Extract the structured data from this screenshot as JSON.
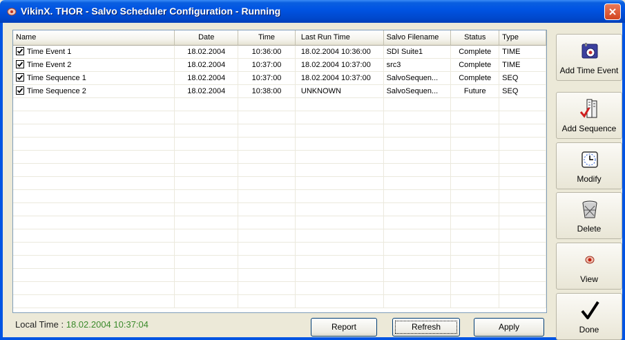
{
  "window": {
    "title": "VikinX. THOR - Salvo Scheduler Configuration - Running"
  },
  "list": {
    "columns": [
      "Name",
      "Date",
      "Time",
      "Last Run Time",
      "Salvo Filename",
      "Status",
      "Type"
    ],
    "rows": [
      {
        "checked": true,
        "name": "Time Event 1",
        "date": "18.02.2004",
        "time": "10:36:00",
        "last_run": "18.02.2004 10:36:00",
        "file": "SDI Suite1",
        "status": "Complete",
        "type": "TIME"
      },
      {
        "checked": true,
        "name": "Time Event 2",
        "date": "18.02.2004",
        "time": "10:37:00",
        "last_run": "18.02.2004 10:37:00",
        "file": "src3",
        "status": "Complete",
        "type": "TIME"
      },
      {
        "checked": true,
        "name": "Time Sequence 1",
        "date": "18.02.2004",
        "time": "10:37:00",
        "last_run": "18.02.2004 10:37:00",
        "file": "SalvoSequen...",
        "status": "Complete",
        "type": "SEQ"
      },
      {
        "checked": true,
        "name": "Time Sequence 2",
        "date": "18.02.2004",
        "time": "10:38:00",
        "last_run": "UNKNOWN",
        "file": "SalvoSequen...",
        "status": "Future",
        "type": "SEQ"
      }
    ]
  },
  "toolbar": {
    "add_time_event": "Add Time Event",
    "add_sequence": "Add Sequence",
    "modify": "Modify",
    "delete": "Delete",
    "view": "View",
    "done": "Done"
  },
  "footer": {
    "local_time_label": "Local Time :",
    "local_time_value": "18.02.2004 10:37:04",
    "report": "Report",
    "refresh": "Refresh",
    "apply": "Apply"
  },
  "colors": {
    "titlebar": "#0054e3",
    "local_time_value": "#3a8a2a",
    "close_button": "#d3461f"
  }
}
